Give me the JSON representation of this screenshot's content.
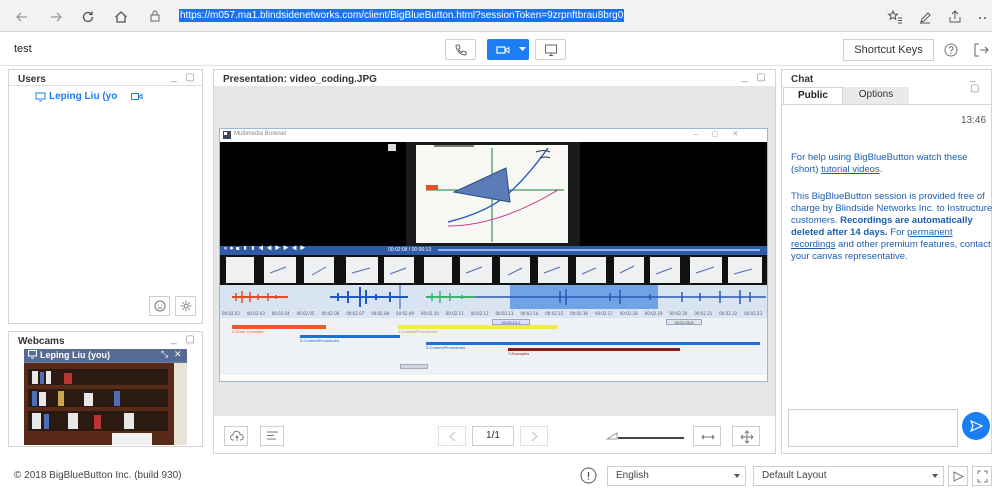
{
  "browser": {
    "url": "https://m057.ma1.blindsidenetworks.com/client/BigBlueButton.html?sessionToken=9zrpnftbrau8brg0"
  },
  "header": {
    "meeting_name": "test",
    "shortcut_keys": "Shortcut Keys"
  },
  "users": {
    "title": "Users",
    "items": [
      {
        "name": "Leping Liu (yo"
      }
    ]
  },
  "webcams": {
    "title": "Webcams",
    "feed_label": "Leping Liu (you)"
  },
  "presentation": {
    "title": "Presentation: video_coding.JPG",
    "page_indicator": "1/1",
    "multimedia_title": "Multimedia Browser",
    "time_display": "00:02:08 / 00:06:13",
    "timeline_ticks": [
      "00:02.02",
      "00:02.03",
      "00:02.04",
      "00:02.05",
      "00:02.06",
      "00:02.07",
      "00:02.08",
      "00:02.09",
      "00:02.10",
      "00:02.11",
      "00:02.12",
      "00:02.13",
      "00:02.14",
      "00:02.15",
      "00:02.16",
      "00:02.17",
      "00:02.18",
      "00:02.19",
      "00:02.20",
      "00:02.21",
      "00:02.22",
      "00:02.23"
    ],
    "marker_a": "00:02:13.2",
    "marker_b": "00:02:20.6",
    "tracks": [
      {
        "label": "3-Team Concepts",
        "color": "#f05a28"
      },
      {
        "label": "1-Content/Procedures",
        "color": "#f3e94a"
      },
      {
        "label": "5-Content/Procedures",
        "color": "#1b6fd8"
      },
      {
        "label": "5-Content/Procedures",
        "color": "#1b6fd8"
      },
      {
        "label": "7-Examples",
        "color": "#8b1a1a"
      }
    ]
  },
  "chat": {
    "title": "Chat",
    "tab_public": "Public",
    "tab_options": "Options",
    "timestamp": "13:46",
    "msg1_before": "For help using BigBlueButton watch these (short) ",
    "msg1_link": "tutorial videos",
    "msg1_after": ".",
    "msg2_a": "This BigBlueButton session is provided free of charge by Blindside Networks Inc. to Instructure customers. ",
    "msg2_bold": "Recordings are automatically deleted after 14 days.",
    "msg2_b": " For ",
    "msg2_link": "permanent recordings",
    "msg2_c": " and other premium features, contact your canvas representative."
  },
  "footer": {
    "copyright": "© 2018 BigBlueButton Inc. (build 930)",
    "language": "English",
    "layout": "Default Layout"
  },
  "colors": {
    "accent": "#1b7ef2",
    "link": "#1a5fb4"
  }
}
